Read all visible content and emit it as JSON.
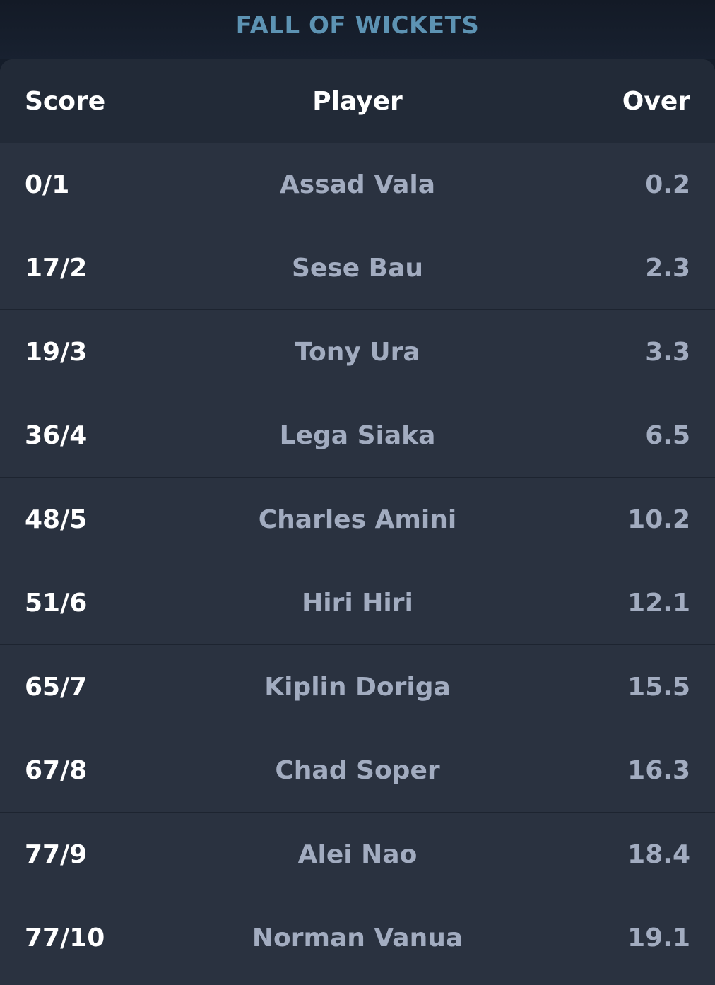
{
  "header": {
    "title": "FALL OF WICKETS"
  },
  "table": {
    "columns": {
      "score": "Score",
      "player": "Player",
      "over": "Over"
    },
    "rows": [
      {
        "score": "0/1",
        "player": "Assad Vala",
        "over": "0.2"
      },
      {
        "score": "17/2",
        "player": "Sese Bau",
        "over": "2.3"
      },
      {
        "score": "19/3",
        "player": "Tony Ura",
        "over": "3.3"
      },
      {
        "score": "36/4",
        "player": "Lega Siaka",
        "over": "6.5"
      },
      {
        "score": "48/5",
        "player": "Charles Amini",
        "over": "10.2"
      },
      {
        "score": "51/6",
        "player": "Hiri Hiri",
        "over": "12.1"
      },
      {
        "score": "65/7",
        "player": "Kiplin Doriga",
        "over": "15.5"
      },
      {
        "score": "67/8",
        "player": "Chad Soper",
        "over": "16.3"
      },
      {
        "score": "77/9",
        "player": "Alei Nao",
        "over": "18.4"
      },
      {
        "score": "77/10",
        "player": "Norman Vanua",
        "over": "19.1"
      }
    ]
  },
  "colors": {
    "title": "#5d93b3",
    "page_background": "#151d2a",
    "card_background": "#2a3240",
    "header_background": "#222a37",
    "score_text": "#ffffff",
    "secondary_text": "#a2acc0"
  }
}
